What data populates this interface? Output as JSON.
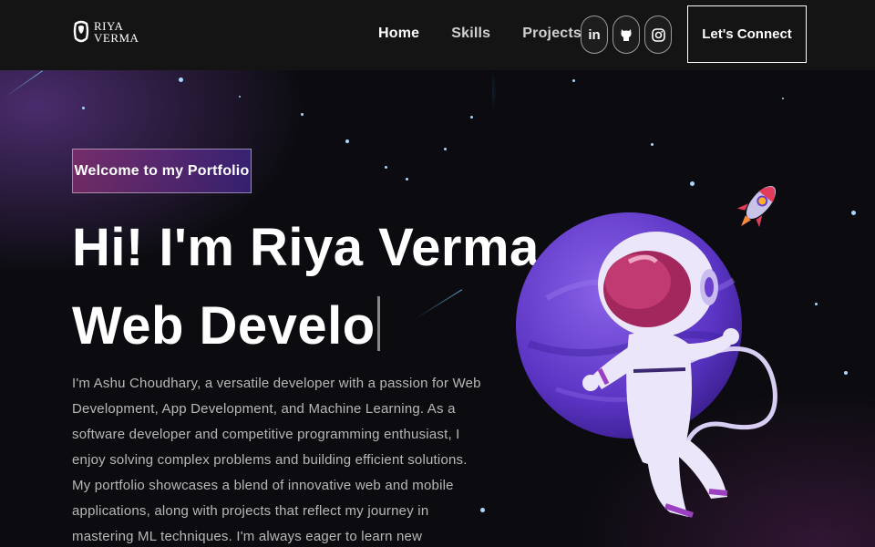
{
  "brand": {
    "line1": "RIYA",
    "line2": "VERMA",
    "icon": "logo-icon"
  },
  "nav": {
    "links": [
      "Home",
      "Skills",
      "Projects"
    ],
    "socials": [
      {
        "icon": "linkedin-icon",
        "glyph": "in"
      },
      {
        "icon": "github-icon",
        "glyph": ""
      },
      {
        "icon": "instagram-icon",
        "glyph": ""
      }
    ],
    "cta": "Let's Connect"
  },
  "hero": {
    "tagline": "Welcome to my Portfolio",
    "headline_line1": "Hi! I'm Riya Verma",
    "headline_line2": "Web Develo",
    "bio": "I'm Ashu Choudhary, a versatile developer with a passion for Web Development, App Development, and Machine Learning. As a software developer and competitive programming enthusiast, I enjoy solving complex problems and building efficient solutions. My portfolio showcases a blend of innovative web and mobile applications, along with projects that reflect my journey in mastering ML techniques. I'm always eager to learn new"
  },
  "colors": {
    "background": "#121212",
    "tagline_gradient_start": "#aa367c",
    "tagline_gradient_end": "#4a2fbd",
    "planet": "#6a3fd0",
    "text_muted": "#b8b8b8"
  }
}
